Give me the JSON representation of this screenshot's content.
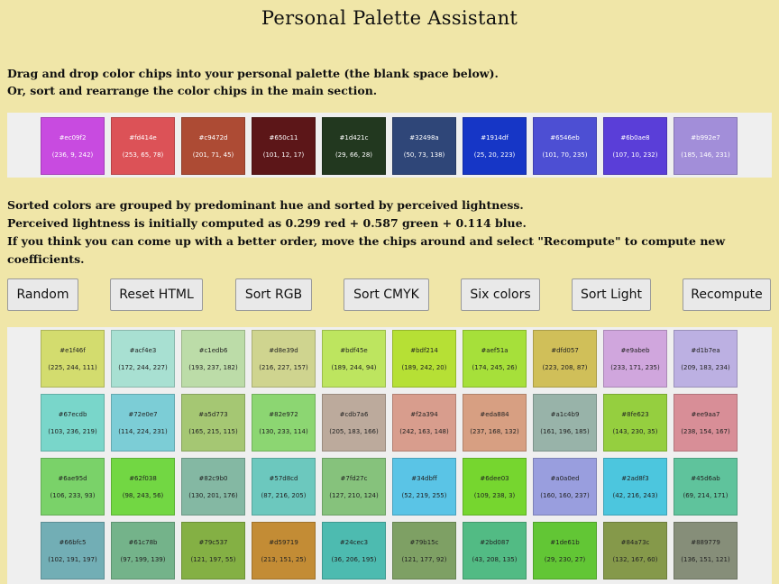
{
  "title": "Personal Palette Assistant",
  "intro": [
    "Drag and drop color chips into your personal palette (the blank space below).",
    "Or, sort and rearrange the color chips in the main section."
  ],
  "notes": [
    "Sorted colors are grouped by predominant hue and sorted by perceived lightness.",
    "Perceived lightness is initially computed as 0.299 red + 0.587 green + 0.114 blue.",
    "If you think you can come up with a better order, move the chips around and select \"Recompute\" to compute new coefficients."
  ],
  "buttons": {
    "random": "Random",
    "reset_html": "Reset HTML",
    "sort_rgb": "Sort RGB",
    "sort_cmyk": "Sort CMYK",
    "six_colors": "Six colors",
    "sort_light": "Sort Light",
    "recompute": "Recompute"
  },
  "palette": [
    {
      "hex": "#ec09f2",
      "rgb": "(236, 9, 242)",
      "color": "#c84be0",
      "text": "dark"
    },
    {
      "hex": "#fd414e",
      "rgb": "(253, 65, 78)",
      "color": "#dc5257",
      "text": "dark"
    },
    {
      "hex": "#c9472d",
      "rgb": "(201, 71, 45)",
      "color": "#ad4b34",
      "text": "dark"
    },
    {
      "hex": "#650c11",
      "rgb": "(101, 12, 17)",
      "color": "#5c1618",
      "text": "dark"
    },
    {
      "hex": "#1d421c",
      "rgb": "(29, 66, 28)",
      "color": "#22381f",
      "text": "dark"
    },
    {
      "hex": "#32498a",
      "rgb": "(50, 73, 138)",
      "color": "#2f4678",
      "text": "dark"
    },
    {
      "hex": "#1914df",
      "rgb": "(25, 20, 223)",
      "color": "#1636c6",
      "text": "dark"
    },
    {
      "hex": "#6546eb",
      "rgb": "(101, 70, 235)",
      "color": "#4d4fd3",
      "text": "dark"
    },
    {
      "hex": "#6b0ae8",
      "rgb": "(107, 10, 232)",
      "color": "#5a3ed8",
      "text": "dark"
    },
    {
      "hex": "#b992e7",
      "rgb": "(185, 146, 231)",
      "color": "#a28ed9",
      "text": "dark"
    }
  ],
  "chips": [
    {
      "hex": "#e1f46f",
      "rgb": "(225, 244, 111)",
      "color": "#d3dc6e",
      "text": "light"
    },
    {
      "hex": "#acf4e3",
      "rgb": "(172, 244, 227)",
      "color": "#a8e0d2",
      "text": "light"
    },
    {
      "hex": "#c1edb6",
      "rgb": "(193, 237, 182)",
      "color": "#bcdca8",
      "text": "light"
    },
    {
      "hex": "#d8e39d",
      "rgb": "(216, 227, 157)",
      "color": "#cfd48f",
      "text": "light"
    },
    {
      "hex": "#bdf45e",
      "rgb": "(189, 244, 94)",
      "color": "#bde55f",
      "text": "light"
    },
    {
      "hex": "#bdf214",
      "rgb": "(189, 242, 20)",
      "color": "#b6e035",
      "text": "light"
    },
    {
      "hex": "#aef51a",
      "rgb": "(174, 245, 26)",
      "color": "#a6e03a",
      "text": "light"
    },
    {
      "hex": "#dfd057",
      "rgb": "(223, 208, 87)",
      "color": "#d0bf59",
      "text": "light"
    },
    {
      "hex": "#e9abeb",
      "rgb": "(233, 171, 235)",
      "color": "#d0a6dd",
      "text": "light"
    },
    {
      "hex": "#d1b7ea",
      "rgb": "(209, 183, 234)",
      "color": "#bcb0e2",
      "text": "light"
    },
    {
      "hex": "#67ecdb",
      "rgb": "(103, 236, 219)",
      "color": "#79d6ca",
      "text": "light"
    },
    {
      "hex": "#72e0e7",
      "rgb": "(114, 224, 231)",
      "color": "#7ccdd6",
      "text": "light"
    },
    {
      "hex": "#a5d773",
      "rgb": "(165, 215, 115)",
      "color": "#a5c773",
      "text": "light"
    },
    {
      "hex": "#82e972",
      "rgb": "(130, 233, 114)",
      "color": "#8cd672",
      "text": "light"
    },
    {
      "hex": "#cdb7a6",
      "rgb": "(205, 183, 166)",
      "color": "#bcaa9c",
      "text": "light"
    },
    {
      "hex": "#f2a394",
      "rgb": "(242, 163, 148)",
      "color": "#d89d8d",
      "text": "light"
    },
    {
      "hex": "#eda884",
      "rgb": "(237, 168, 132)",
      "color": "#d79f82",
      "text": "light"
    },
    {
      "hex": "#a1c4b9",
      "rgb": "(161, 196, 185)",
      "color": "#98b3a9",
      "text": "light"
    },
    {
      "hex": "#8fe623",
      "rgb": "(143, 230, 35)",
      "color": "#95cf3f",
      "text": "light"
    },
    {
      "hex": "#ee9aa7",
      "rgb": "(238, 154, 167)",
      "color": "#d88e97",
      "text": "light"
    },
    {
      "hex": "#6ae95d",
      "rgb": "(106, 233, 93)",
      "color": "#7ad269",
      "text": "light"
    },
    {
      "hex": "#62f038",
      "rgb": "(98, 243, 56)",
      "color": "#72d743",
      "text": "light"
    },
    {
      "hex": "#82c9b0",
      "rgb": "(130, 201, 176)",
      "color": "#84b8a3",
      "text": "light"
    },
    {
      "hex": "#57d8cd",
      "rgb": "(87, 216, 205)",
      "color": "#6cc8be",
      "text": "light"
    },
    {
      "hex": "#7fd27c",
      "rgb": "(127, 210, 124)",
      "color": "#86c27c",
      "text": "light"
    },
    {
      "hex": "#34dbff",
      "rgb": "(52, 219, 255)",
      "color": "#5ac4e6",
      "text": "light"
    },
    {
      "hex": "#6dee03",
      "rgb": "(109, 238, 3)",
      "color": "#76d62f",
      "text": "light"
    },
    {
      "hex": "#a0a0ed",
      "rgb": "(160, 160, 237)",
      "color": "#999ede",
      "text": "light"
    },
    {
      "hex": "#2ad8f3",
      "rgb": "(42, 216, 243)",
      "color": "#4cc6de",
      "text": "light"
    },
    {
      "hex": "#45d6ab",
      "rgb": "(69, 214, 171)",
      "color": "#5fc39c",
      "text": "light"
    },
    {
      "hex": "#66bfc5",
      "rgb": "(102, 191, 197)",
      "color": "#72aeb5",
      "text": "light"
    },
    {
      "hex": "#61c78b",
      "rgb": "(97, 199, 139)",
      "color": "#74b38a",
      "text": "light"
    },
    {
      "hex": "#79c537",
      "rgb": "(121, 197, 55)",
      "color": "#84b044",
      "text": "light"
    },
    {
      "hex": "#d59719",
      "rgb": "(213, 151, 25)",
      "color": "#c38c35",
      "text": "light"
    },
    {
      "hex": "#24cec3",
      "rgb": "(36, 206, 195)",
      "color": "#4dbbb0",
      "text": "light"
    },
    {
      "hex": "#79b15c",
      "rgb": "(121, 177, 92)",
      "color": "#7ea064",
      "text": "light"
    },
    {
      "hex": "#2bd087",
      "rgb": "(43, 208, 135)",
      "color": "#52bb84",
      "text": "light"
    },
    {
      "hex": "#1de61b",
      "rgb": "(29, 230, 27)",
      "color": "#62c635",
      "text": "light"
    },
    {
      "hex": "#84a73c",
      "rgb": "(132, 167, 60)",
      "color": "#85994a",
      "text": "light"
    },
    {
      "hex": "#889779",
      "rgb": "(136, 151, 121)",
      "color": "#868e79",
      "text": "light"
    }
  ]
}
